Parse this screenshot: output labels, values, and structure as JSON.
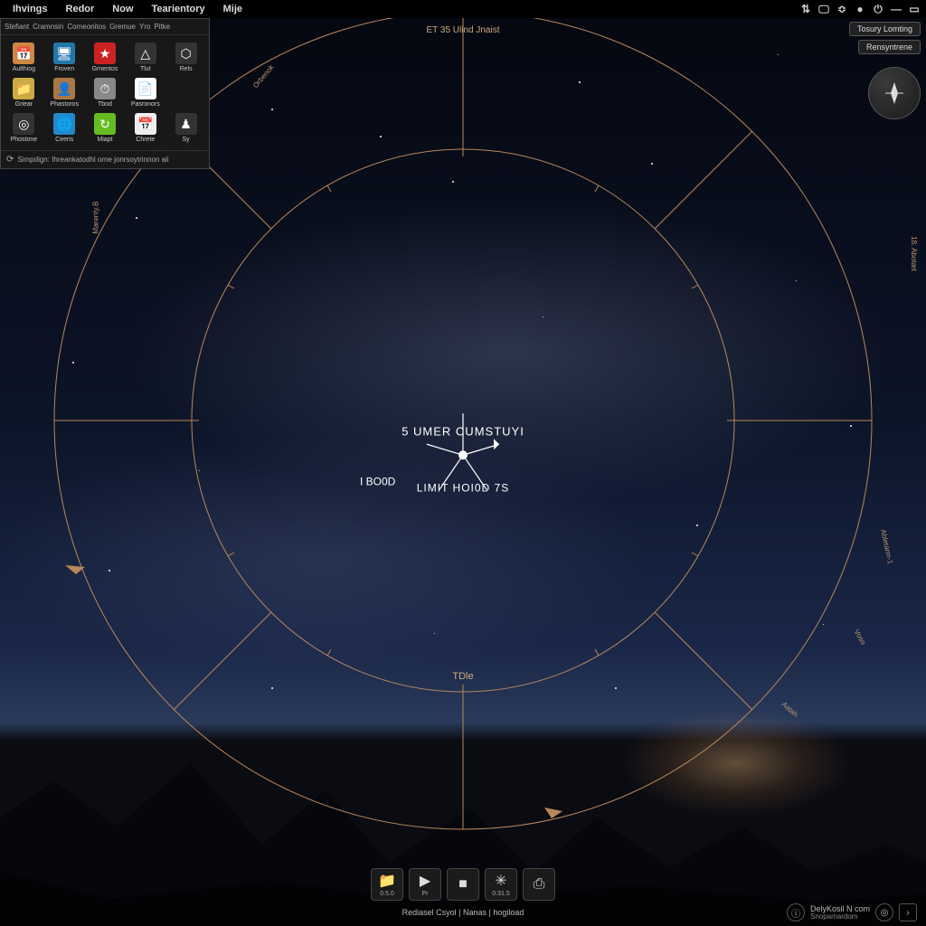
{
  "menubar": {
    "items": [
      "Ihvings",
      "Redor",
      "Now",
      "Tearientory",
      "Mije"
    ]
  },
  "tray": {
    "icons": [
      "wifi-icon",
      "display-icon",
      "bluetooth-icon",
      "volume-icon",
      "power-icon",
      "minimize-icon",
      "window-icon"
    ]
  },
  "launcher": {
    "tabs": [
      "Stefiant",
      "Cramnsin",
      "Comeonitos",
      "Gremue",
      "Yro",
      "Pitke"
    ],
    "apps": [
      {
        "label": "Aulthiog",
        "icon": "📅",
        "bg": "#c84"
      },
      {
        "label": "Froven",
        "icon": "🖥",
        "bg": "#27a"
      },
      {
        "label": "Grnentos",
        "icon": "★",
        "bg": "#c22"
      },
      {
        "label": "Tlut",
        "icon": "△",
        "bg": "#333"
      },
      {
        "label": "Rels",
        "icon": "⬡",
        "bg": "#333"
      },
      {
        "label": "Griear",
        "icon": "📁",
        "bg": "#ca4"
      },
      {
        "label": "Phastoros",
        "icon": "👤",
        "bg": "#a74"
      },
      {
        "label": "Tbod",
        "icon": "⏱",
        "bg": "#888"
      },
      {
        "label": "Pasronors",
        "icon": "📄",
        "bg": "#fff"
      },
      {
        "label": "",
        "icon": " ",
        "bg": "transparent"
      },
      {
        "label": "Phostone",
        "icon": "◎",
        "bg": "#333"
      },
      {
        "label": "Cireris",
        "icon": "🌐",
        "bg": "#28c"
      },
      {
        "label": "Miapt",
        "icon": "↻",
        "bg": "#6b2"
      },
      {
        "label": "Chrete",
        "icon": "📅",
        "bg": "#eee"
      },
      {
        "label": "Sy",
        "icon": "♟",
        "bg": "#333"
      }
    ],
    "footer": "Simpdign: Ihreankatodhl orne jonrsoytrinnon ali"
  },
  "top_right": {
    "pill1": "Tosury Lomting",
    "pill2": "Rensyntrene"
  },
  "dial": {
    "top_label": "ET 35  Ulind Jnaist",
    "center_top": "5 UMER CUMSTUYI",
    "center_left": "I BO0D",
    "center_bottom": "LIMIT HOI0D 7S",
    "tide_label": "TDle",
    "perimeter": [
      {
        "text": "Orbenok",
        "angle": -58
      },
      {
        "text": "Marenty.B",
        "angle": -105
      },
      {
        "text": "18. Abotæt",
        "angle": 65
      },
      {
        "text": "Abletarm-1",
        "angle": 105
      },
      {
        "text": "Voso",
        "angle": 135
      },
      {
        "text": "Aatah",
        "angle": 150
      }
    ]
  },
  "dock": {
    "items": [
      {
        "glyph": "📁",
        "caption": "0.5.0"
      },
      {
        "glyph": "▶",
        "caption": "Pr"
      },
      {
        "glyph": "■",
        "caption": ""
      },
      {
        "glyph": "✳",
        "caption": "0:31.5"
      },
      {
        "glyph": "⎙",
        "caption": ""
      }
    ]
  },
  "status": {
    "center": "Rediasel  Csyol  |  Nanas  |  hogiload",
    "right_line1": "DelyKosil N com",
    "right_line2": "Snopamardom"
  },
  "colors": {
    "ring": "#b8875a"
  }
}
